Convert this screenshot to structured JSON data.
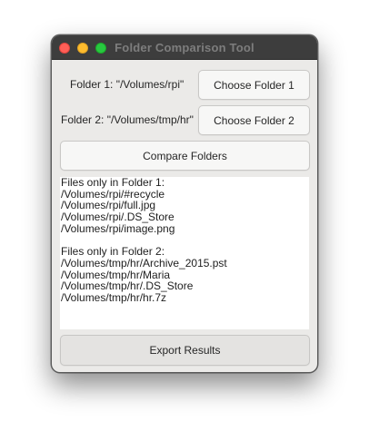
{
  "window": {
    "title": "Folder Comparison Tool"
  },
  "folder1": {
    "label": "Folder 1: \"/Volumes/rpi\"",
    "button_label": "Choose Folder 1"
  },
  "folder2": {
    "label": "Folder 2: \"/Volumes/tmp/hr\"",
    "button_label": "Choose Folder 2"
  },
  "compare_button_label": "Compare Folders",
  "results": {
    "lines": [
      "Files only in Folder 1:",
      "/Volumes/rpi/#recycle",
      "/Volumes/rpi/full.jpg",
      "/Volumes/rpi/.DS_Store",
      "/Volumes/rpi/image.png",
      "",
      "Files only in Folder 2:",
      "/Volumes/tmp/hr/Archive_2015.pst",
      "/Volumes/tmp/hr/Maria",
      "/Volumes/tmp/hr/.DS_Store",
      "/Volumes/tmp/hr/hr.7z"
    ]
  },
  "export_button_label": "Export Results",
  "colors": {
    "close": "#ff5f57",
    "minimize": "#febc2e",
    "zoom": "#28c840",
    "titlebar": "#3d3d3d",
    "window_bg": "#ebeae8"
  }
}
